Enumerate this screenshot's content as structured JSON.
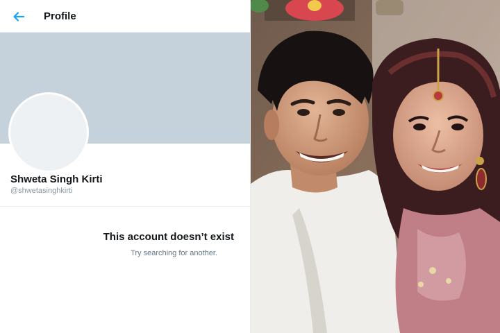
{
  "header": {
    "back_icon": "back-arrow-icon",
    "title": "Profile"
  },
  "profile": {
    "name": "Shweta Singh Kirti",
    "handle": "@shwetasinghkirti"
  },
  "empty_state": {
    "title": "This account doesn’t exist",
    "subtitle": "Try searching for another."
  },
  "colors": {
    "accent": "#1da1f2",
    "banner": "#c6d2db",
    "avatar": "#eef1f4"
  }
}
